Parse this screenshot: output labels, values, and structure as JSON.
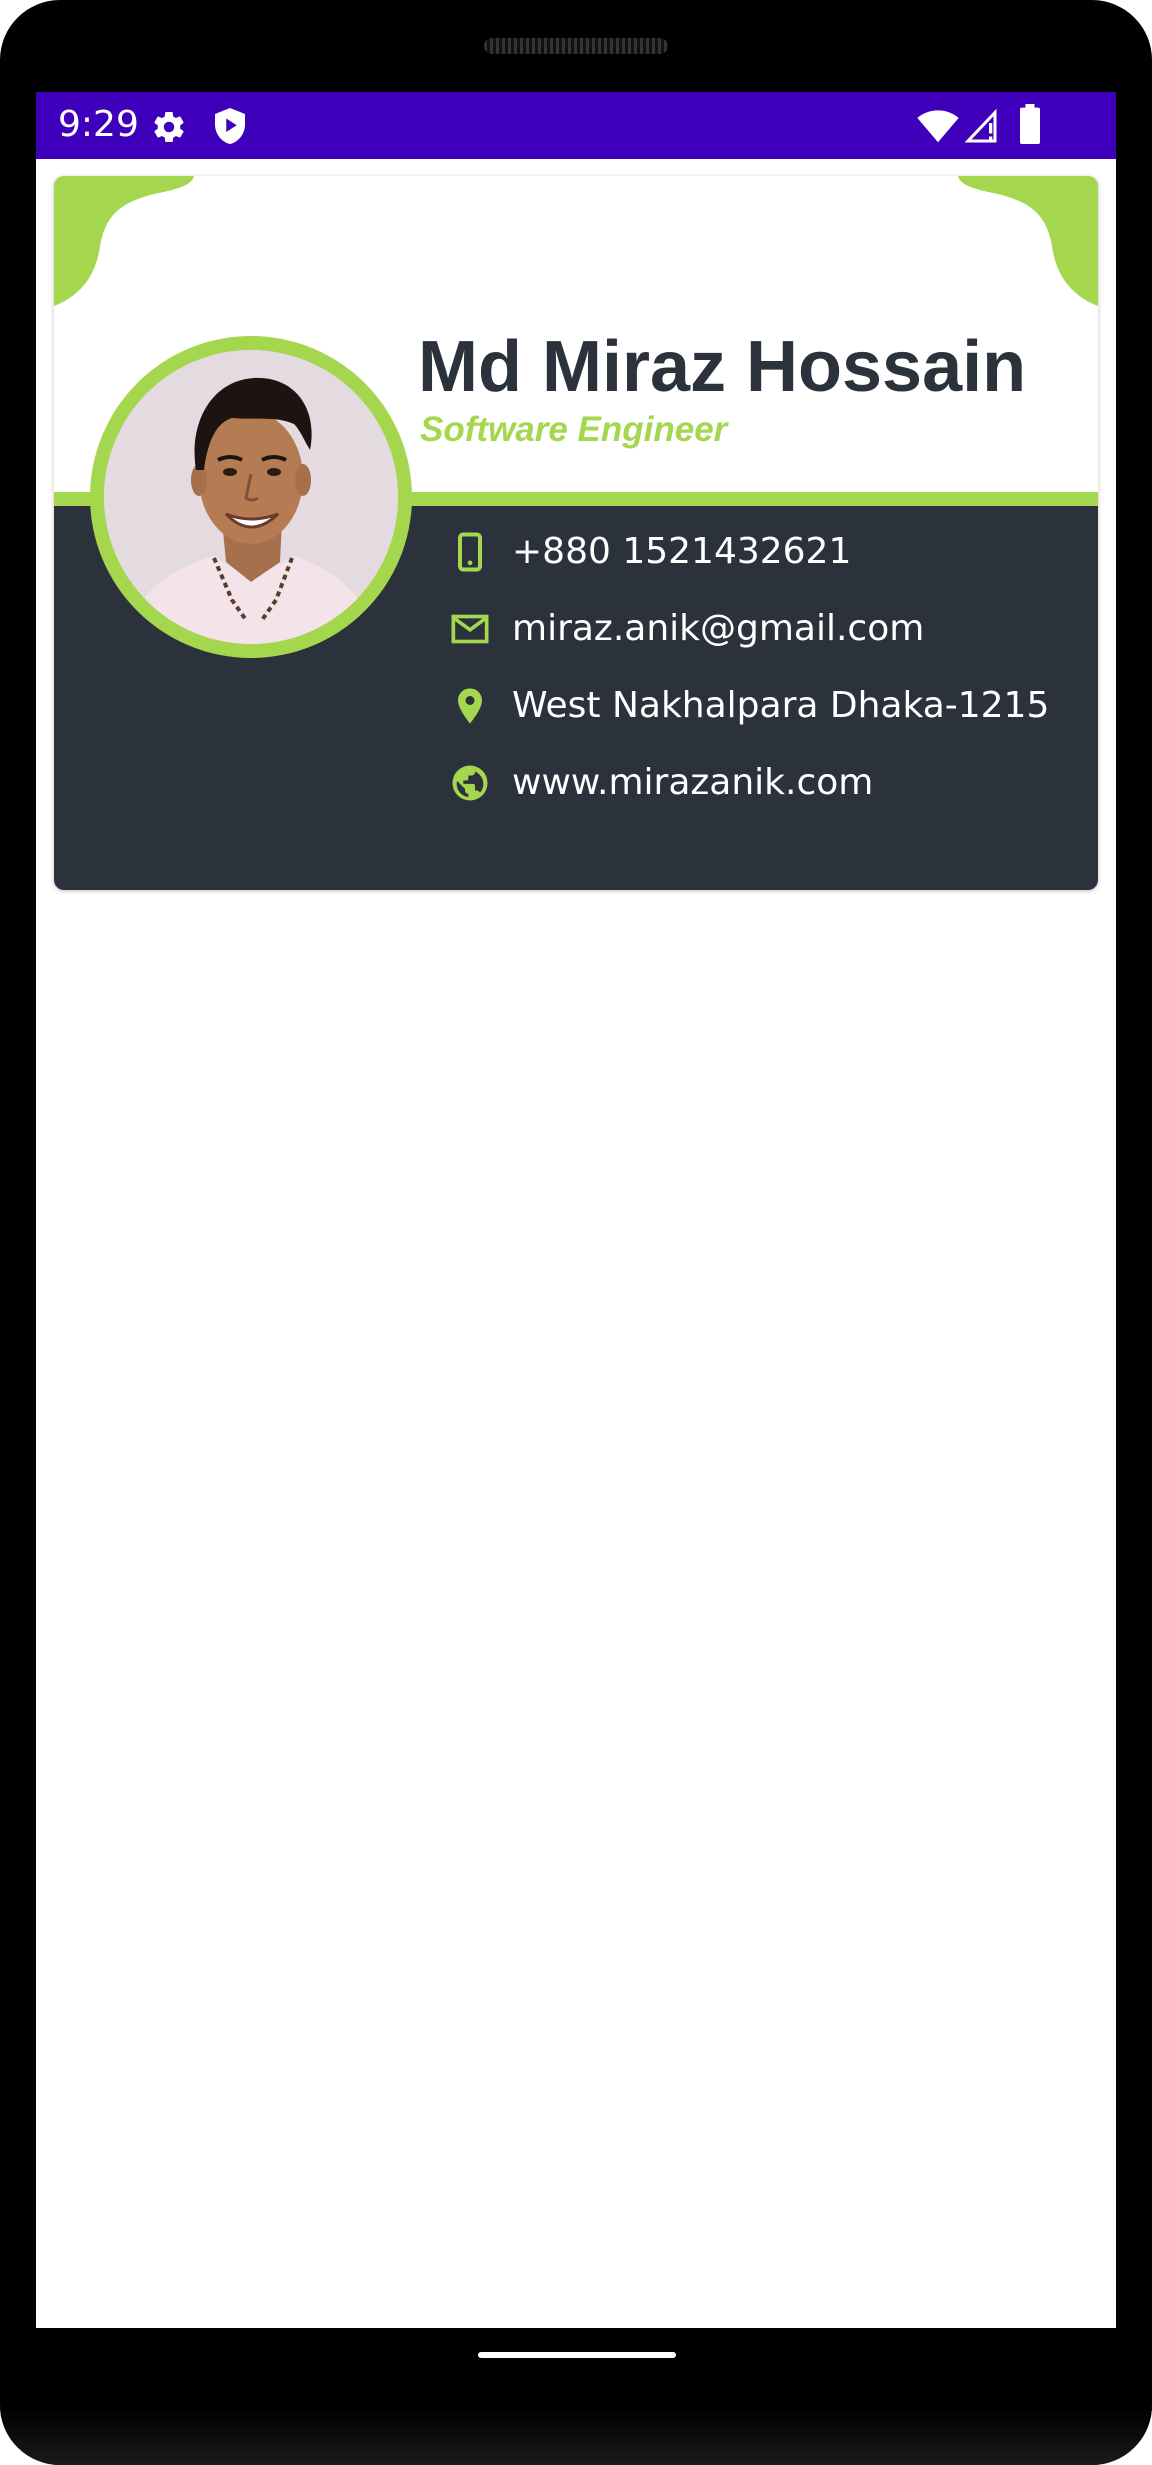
{
  "status_bar": {
    "time": "9:29",
    "icons": [
      "settings-gear-icon",
      "shield-play-icon",
      "wifi-icon",
      "cell-signal-icon",
      "battery-icon"
    ],
    "background": "#3f00bb"
  },
  "card": {
    "name": "Md Miraz Hossain",
    "role": "Software Engineer",
    "avatar": "profile-photo",
    "colors": {
      "accent": "#a4d64e",
      "dark": "#2b323c",
      "light": "#ffffff"
    },
    "contacts": [
      {
        "icon": "phone-icon",
        "text": "+880 1521432621"
      },
      {
        "icon": "mail-icon",
        "text": "miraz.anik@gmail.com"
      },
      {
        "icon": "location-pin-icon",
        "text": "West Nakhalpara Dhaka-1215"
      },
      {
        "icon": "globe-icon",
        "text": "www.mirazanik.com"
      }
    ]
  }
}
